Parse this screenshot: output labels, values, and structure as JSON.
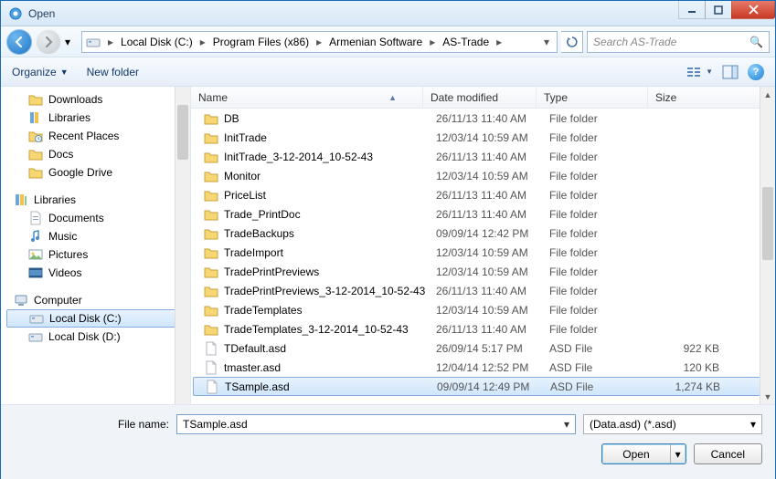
{
  "window": {
    "title": "Open"
  },
  "nav": {
    "crumbs": [
      "Local Disk (C:)",
      "Program Files (x86)",
      "Armenian Software",
      "AS-Trade"
    ],
    "search_placeholder": "Search AS-Trade"
  },
  "toolbar": {
    "organize": "Organize",
    "newfolder": "New folder"
  },
  "tree": {
    "top": [
      {
        "label": "Downloads",
        "icon": "folder"
      },
      {
        "label": "Libraries",
        "icon": "libraries"
      },
      {
        "label": "Recent Places",
        "icon": "recent"
      },
      {
        "label": "Docs",
        "icon": "folder"
      },
      {
        "label": "Google Drive",
        "icon": "folder"
      }
    ],
    "libs_header": "Libraries",
    "libs": [
      {
        "label": "Documents",
        "icon": "doc"
      },
      {
        "label": "Music",
        "icon": "music"
      },
      {
        "label": "Pictures",
        "icon": "pic"
      },
      {
        "label": "Videos",
        "icon": "vid"
      }
    ],
    "comp_header": "Computer",
    "drives": [
      {
        "label": "Local Disk (C:)",
        "selected": true
      },
      {
        "label": "Local Disk (D:)",
        "selected": false
      }
    ]
  },
  "columns": {
    "name": "Name",
    "date": "Date modified",
    "type": "Type",
    "size": "Size"
  },
  "files": [
    {
      "name": "DB",
      "date": "26/11/13 11:40 AM",
      "type": "File folder",
      "size": "",
      "icon": "folder"
    },
    {
      "name": "InitTrade",
      "date": "12/03/14 10:59 AM",
      "type": "File folder",
      "size": "",
      "icon": "folder"
    },
    {
      "name": "InitTrade_3-12-2014_10-52-43",
      "date": "26/11/13 11:40 AM",
      "type": "File folder",
      "size": "",
      "icon": "folder"
    },
    {
      "name": "Monitor",
      "date": "12/03/14 10:59 AM",
      "type": "File folder",
      "size": "",
      "icon": "folder"
    },
    {
      "name": "PriceList",
      "date": "26/11/13 11:40 AM",
      "type": "File folder",
      "size": "",
      "icon": "folder"
    },
    {
      "name": "Trade_PrintDoc",
      "date": "26/11/13 11:40 AM",
      "type": "File folder",
      "size": "",
      "icon": "folder"
    },
    {
      "name": "TradeBackups",
      "date": "09/09/14 12:42 PM",
      "type": "File folder",
      "size": "",
      "icon": "folder"
    },
    {
      "name": "TradeImport",
      "date": "12/03/14 10:59 AM",
      "type": "File folder",
      "size": "",
      "icon": "folder"
    },
    {
      "name": "TradePrintPreviews",
      "date": "12/03/14 10:59 AM",
      "type": "File folder",
      "size": "",
      "icon": "folder"
    },
    {
      "name": "TradePrintPreviews_3-12-2014_10-52-43",
      "date": "26/11/13 11:40 AM",
      "type": "File folder",
      "size": "",
      "icon": "folder"
    },
    {
      "name": "TradeTemplates",
      "date": "12/03/14 10:59 AM",
      "type": "File folder",
      "size": "",
      "icon": "folder"
    },
    {
      "name": "TradeTemplates_3-12-2014_10-52-43",
      "date": "26/11/13 11:40 AM",
      "type": "File folder",
      "size": "",
      "icon": "folder"
    },
    {
      "name": "TDefault.asd",
      "date": "26/09/14 5:17 PM",
      "type": "ASD File",
      "size": "922 KB",
      "icon": "file"
    },
    {
      "name": "tmaster.asd",
      "date": "12/04/14 12:52 PM",
      "type": "ASD File",
      "size": "120 KB",
      "icon": "file"
    },
    {
      "name": "TSample.asd",
      "date": "09/09/14 12:49 PM",
      "type": "ASD File",
      "size": "1,274 KB",
      "icon": "file",
      "selected": true
    }
  ],
  "bottom": {
    "filename_label": "File name:",
    "filename_value": "TSample.asd",
    "filter": "(Data.asd) (*.asd)",
    "open": "Open",
    "cancel": "Cancel"
  }
}
